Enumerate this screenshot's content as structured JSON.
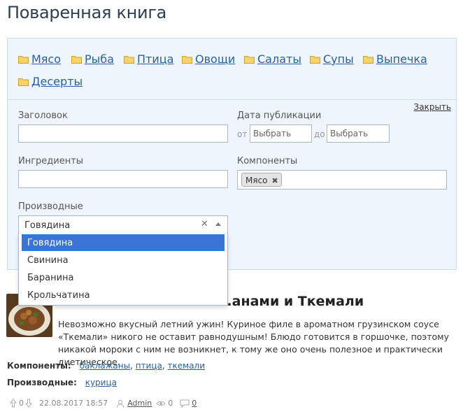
{
  "page": {
    "title": "Поваренная книга"
  },
  "categories": [
    {
      "label": "Мясо"
    },
    {
      "label": "Рыба"
    },
    {
      "label": "Птица"
    },
    {
      "label": "Овощи"
    },
    {
      "label": "Салаты"
    },
    {
      "label": "Супы"
    },
    {
      "label": "Выпечка"
    },
    {
      "label": "Десерты"
    }
  ],
  "filters": {
    "close_label": "Закрыть",
    "title_label": "Заголовок",
    "date_label": "Дата публикации",
    "date_from_prefix": "от",
    "date_to_prefix": "до",
    "date_from_placeholder": "Выбрать",
    "date_to_placeholder": "Выбрать",
    "ingredients_label": "Ингредиенты",
    "components_label": "Компоненты",
    "components_chip": "Мясо",
    "components_chip_remove": "✖",
    "derived_label": "Производные",
    "derived_selected": "Говядина",
    "derived_options": [
      "Говядина",
      "Свинина",
      "Баранина",
      "Крольчатина"
    ]
  },
  "recipe": {
    "title_visible": "...анами и Ткемали",
    "description": "Невозможно вкусный летний ужин! Куриное филе в ароматном грузинском соусе «Ткемали» никого не оставит равнодушным! Блюдо готовится в горшочке, поэтому никакой мороки с ним не возникнет, к тому же оно очень полезное и практически диетическое.",
    "components_key": "Компоненты:",
    "components": [
      "баклажаны",
      "птица",
      "ткемали"
    ],
    "derived_key": "Производные:",
    "derived": [
      "курица"
    ],
    "votes_up": "0",
    "votes_down": "0",
    "date": "22.08.2017 18:57",
    "author": "Admin",
    "views": "0",
    "comments": "0"
  },
  "colors": {
    "accent": "#2a5f9e",
    "panel_bg": "#eef5fc",
    "highlight": "#3875d7"
  }
}
